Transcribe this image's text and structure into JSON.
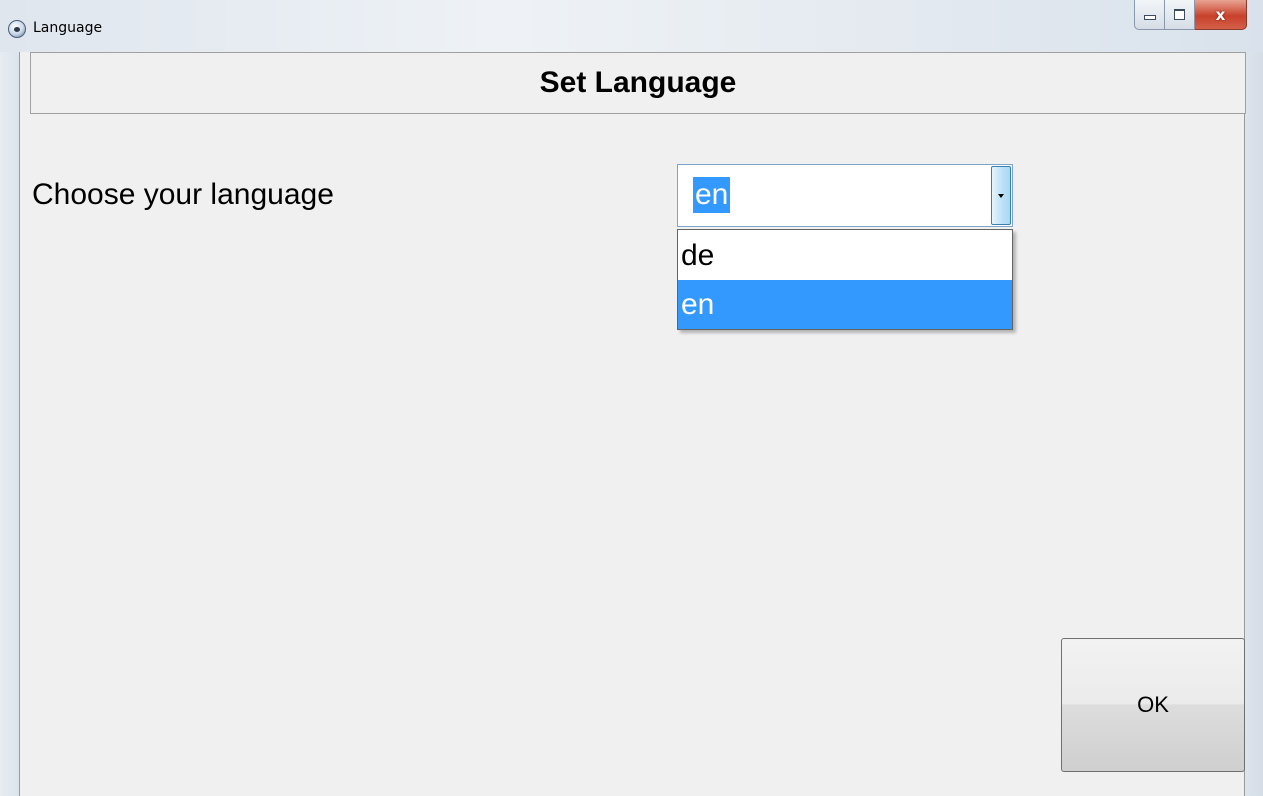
{
  "window": {
    "title": "Language",
    "icon": "app-icon",
    "caption_buttons": {
      "minimize_icon": "minimize-icon",
      "maximize_icon": "maximize-icon",
      "close_icon": "close-icon",
      "close_glyph": "x"
    }
  },
  "header": {
    "title": "Set Language"
  },
  "form": {
    "choose_label": "Choose your language",
    "language_select": {
      "selected_value": "en",
      "options": [
        "de",
        "en"
      ],
      "highlighted_option": "en",
      "expanded": true
    }
  },
  "buttons": {
    "ok_label": "OK"
  },
  "colors": {
    "selection_highlight": "#3399ff",
    "client_background": "#f0f0f0",
    "close_button": "#c8412a"
  }
}
